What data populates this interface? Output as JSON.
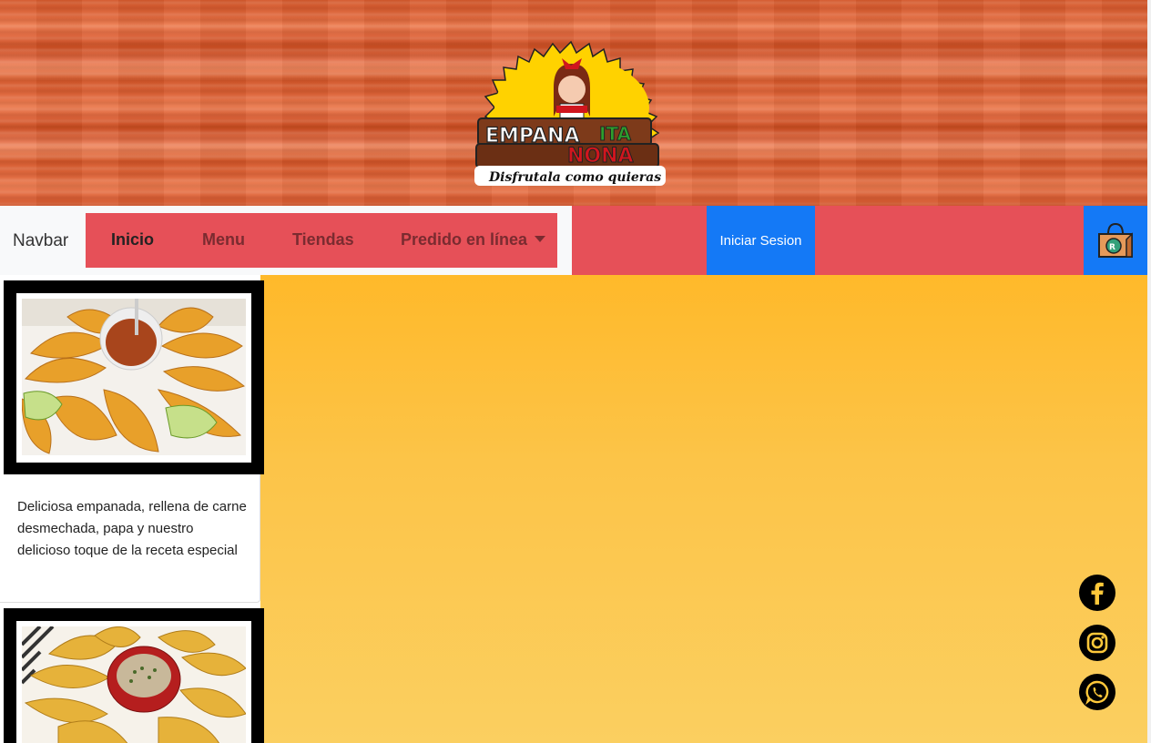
{
  "header": {
    "logo": {
      "line1": "EMPANA",
      "line1b": "ITA",
      "line2": "NONA",
      "tagline": "Disfrutala como quieras"
    }
  },
  "navbar": {
    "brand": "Navbar",
    "links": [
      {
        "label": "Inicio",
        "active": true
      },
      {
        "label": "Menu",
        "active": false
      },
      {
        "label": "Tiendas",
        "active": false
      },
      {
        "label": "Predido en línea",
        "active": false,
        "dropdown": true
      }
    ],
    "login_label": "Iniciar Sesion",
    "cart_icon": "shopping-bag-icon"
  },
  "products": [
    {
      "image": "empanadas-with-sauce-photo",
      "description": "Deliciosa empanada, rellena de carne desmechada, papa y nuestro delicioso toque de la receta especial"
    },
    {
      "image": "empanadas-with-aji-photo"
    }
  ],
  "social": [
    {
      "icon": "facebook-icon"
    },
    {
      "icon": "instagram-icon"
    },
    {
      "icon": "whatsapp-icon"
    }
  ],
  "colors": {
    "nav_red": "#e65058",
    "button_blue": "#1479f6",
    "gradient_top": "#ffb92a",
    "gradient_bottom": "#fbcf60",
    "logo_yellow": "#ffd200"
  }
}
